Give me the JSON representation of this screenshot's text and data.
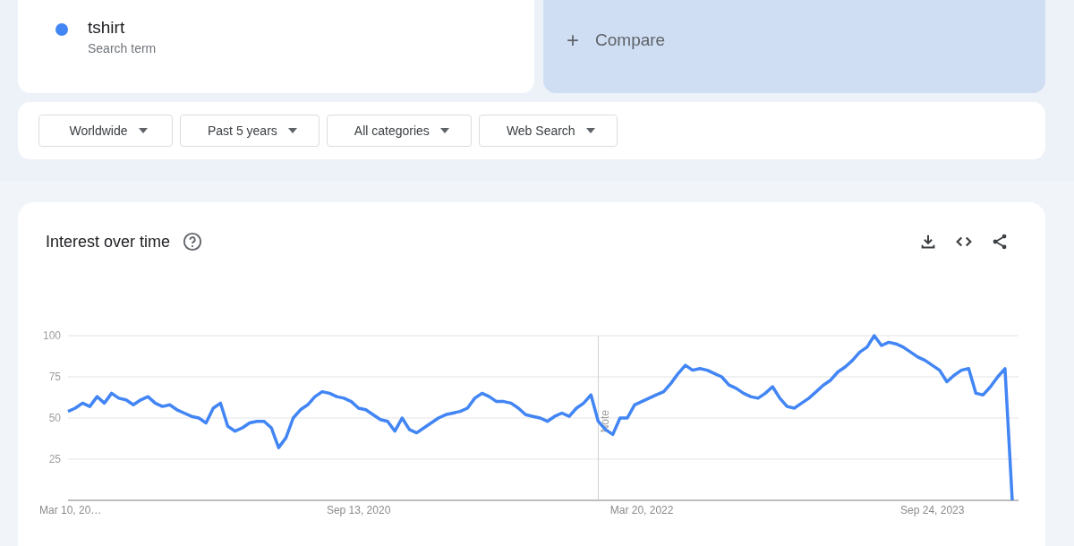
{
  "search_term": {
    "term": "tshirt",
    "caption": "Search term"
  },
  "compare": {
    "icon": "+",
    "label": "Compare"
  },
  "filters": [
    {
      "label": "Worldwide"
    },
    {
      "label": "Past 5 years"
    },
    {
      "label": "All categories"
    },
    {
      "label": "Web Search"
    }
  ],
  "interest_card": {
    "title": "Interest over time",
    "note_label": "Note",
    "chart_data": {
      "type": "line",
      "grid": true,
      "ylim": [
        0,
        100
      ],
      "yticks": [
        25,
        50,
        75,
        100
      ],
      "categories": [
        "Mar 10, 20…",
        null,
        null,
        null,
        null,
        null,
        null,
        null,
        null,
        null,
        null,
        null,
        null,
        null,
        null,
        null,
        null,
        null,
        null,
        null,
        null,
        null,
        null,
        null,
        null,
        null,
        null,
        null,
        null,
        null,
        null,
        null,
        null,
        null,
        null,
        null,
        null,
        null,
        null,
        null,
        "Sep 13, 2020",
        null,
        null,
        null,
        null,
        null,
        null,
        null,
        null,
        null,
        null,
        null,
        null,
        null,
        null,
        null,
        null,
        null,
        null,
        null,
        null,
        null,
        null,
        null,
        null,
        null,
        null,
        null,
        null,
        null,
        null,
        null,
        null,
        null,
        null,
        null,
        null,
        null,
        null,
        "Mar 20, 2022",
        null,
        null,
        null,
        null,
        null,
        null,
        null,
        null,
        null,
        null,
        null,
        null,
        null,
        null,
        null,
        null,
        null,
        null,
        null,
        null,
        null,
        null,
        null,
        null,
        null,
        null,
        null,
        null,
        null,
        null,
        null,
        null,
        null,
        null,
        null,
        null,
        null,
        null,
        null,
        "Sep 24, 2023",
        null,
        null,
        null,
        null,
        null,
        null,
        null,
        null,
        null,
        null,
        null
      ],
      "series": [
        {
          "color": "#4285f4",
          "values": [
            54,
            56,
            59,
            57,
            63,
            59,
            65,
            62,
            61,
            58,
            61,
            63,
            59,
            57,
            58,
            55,
            53,
            51,
            50,
            47,
            56,
            59,
            45,
            42,
            44,
            47,
            48,
            48,
            44,
            32,
            38,
            50,
            55,
            58,
            63,
            66,
            65,
            63,
            62,
            60,
            56,
            55,
            52,
            49,
            48,
            42,
            50,
            43,
            41,
            44,
            47,
            50,
            52,
            53,
            54,
            56,
            62,
            65,
            63,
            60,
            60,
            59,
            56,
            52,
            51,
            50,
            48,
            51,
            53,
            51,
            56,
            59,
            64,
            48,
            43,
            40,
            50,
            50,
            58,
            60,
            62,
            64,
            66,
            71,
            77,
            82,
            79,
            80,
            79,
            77,
            75,
            70,
            68,
            65,
            63,
            62,
            65,
            69,
            62,
            57,
            56,
            59,
            62,
            66,
            70,
            73,
            78,
            81,
            85,
            90,
            93,
            100,
            94,
            96,
            95,
            93,
            90,
            87,
            85,
            82,
            79,
            72,
            76,
            79,
            80,
            65,
            64,
            69,
            75,
            80,
            0
          ]
        }
      ]
    }
  }
}
